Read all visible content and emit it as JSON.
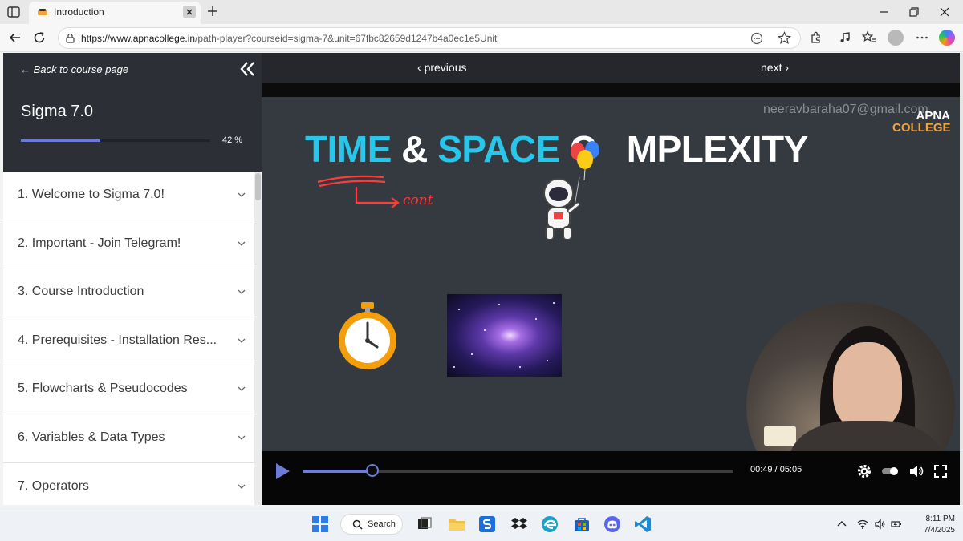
{
  "browser": {
    "tab_title": "Introduction",
    "url_host": "https://www.apnacollege.in",
    "url_path": "/path-player?courseid=sigma-7&unit=67fbc82659d1247b4a0ec1e5Unit"
  },
  "sidebar": {
    "back_label": "Back to course page",
    "course_title": "Sigma 7.0",
    "progress_label": "42 %",
    "progress_value": 0.42,
    "lessons": [
      {
        "label": "1. Welcome to Sigma 7.0!"
      },
      {
        "label": "2. Important - Join Telegram!"
      },
      {
        "label": "3. Course Introduction"
      },
      {
        "label": "4. Prerequisites - Installation Res..."
      },
      {
        "label": "5. Flowcharts & Pseudocodes"
      },
      {
        "label": "6. Variables & Data Types"
      },
      {
        "label": "7. Operators"
      }
    ]
  },
  "player": {
    "previous_label": "previous",
    "next_label": "next",
    "watermark": "neeravbaraha07@gmail.com",
    "brand_line1": "APNA",
    "brand_line2": "COLLEGE",
    "headline_time": "TIME",
    "headline_amp": "&",
    "headline_space": "SPACE",
    "headline_c": "C",
    "headline_rest": "MPLEXITY",
    "scribble_text": "cont",
    "time_display": "00:49 / 05:05",
    "played_fraction": 0.16
  },
  "taskbar": {
    "search_label": "Search",
    "time": "8:11 PM",
    "date": "7/4/2025"
  },
  "colors": {
    "accent": "#6c7bd6",
    "sidebar_header": "#2c2f36",
    "headline_cyan": "#27c6ea",
    "brand_orange": "#f3a23a"
  }
}
